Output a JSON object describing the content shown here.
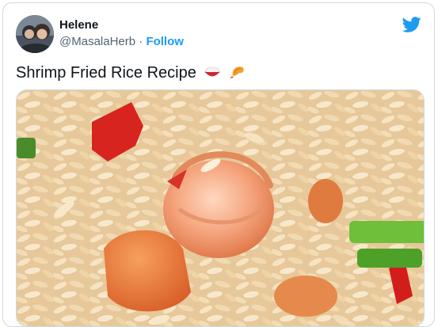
{
  "tweet": {
    "author": {
      "display_name": "Helene",
      "handle": "@MasalaHerb",
      "separator": "·",
      "follow_label": "Follow"
    },
    "text": "Shrimp Fried Rice Recipe",
    "emojis": [
      "rice-bowl-icon",
      "fried-shrimp-icon"
    ],
    "media": {
      "kind": "photo",
      "subject": "shrimp-fried-rice",
      "link_preview_text": "…"
    }
  },
  "colors": {
    "accent": "#1d9bf0",
    "text_primary": "#0f1419",
    "text_secondary": "#536471",
    "border": "#cfd9de"
  }
}
